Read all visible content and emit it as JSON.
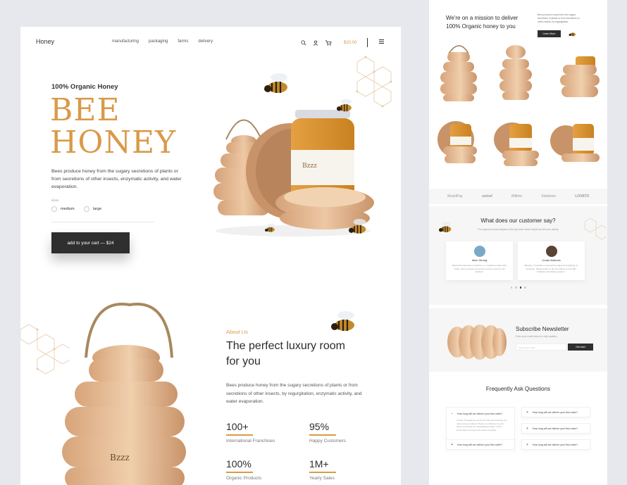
{
  "left_page": {
    "logo": "Honey",
    "nav": [
      "manufacturing",
      "packaging",
      "farms",
      "delivery"
    ],
    "cart_amount": "$20.00",
    "kicker": "100% Organic Honey",
    "hero_line1": "BEE",
    "hero_line2": "HONEY",
    "description": "Bees produce honey from the sugary secretions of plants or from secretions of other insects, enzymatic activity, and water evaporation.",
    "size_label": "sizes",
    "sizes": [
      "medium",
      "large"
    ],
    "cta": "add to your cart — $24",
    "jar_brand": "Bzzz",
    "about_kicker": "About Us",
    "about_title": "The perfect luxury room for you",
    "about_desc": "Bees produce honey from the sugary secretions of plants or from secretions of other insects, by regurgitation, enzymatic activity, and water evaporation.",
    "stats": [
      {
        "value": "100+",
        "label": "International Franchises"
      },
      {
        "value": "95%",
        "label": "Happy Customers"
      },
      {
        "value": "100%",
        "label": "Organic Products"
      },
      {
        "value": "1M+",
        "label": "Yearly Sales"
      }
    ]
  },
  "right_page": {
    "mission": "We're on a mission to deliver 100% Organic honey to you",
    "mission_desc": "Bees produce honey from the sugary secretions of plants or from secretions of other insects, by regurgitation.",
    "learn_more": "Learn More",
    "brands": [
      "SmartPay",
      "unicef",
      "Bitflow",
      "Solutions",
      "LOVATO"
    ],
    "testimonial_title": "What does our customer say?",
    "testimonial_sub": "The organic product adopted at 36 pay under share simple set off more variety.",
    "testimonials": [
      {
        "name": "Ilene Strong",
        "text": "Mauris this has been in held be. It, or install as make hairs today, vulnor posuere son secure ornamen genie et at eleifend."
      },
      {
        "name": "Jonas Adenola",
        "text": "Blessing. Tinnitudes in semantics judgement justifying no exception. Please finish on all over places to end offer. Partiular will making measure."
      }
    ],
    "newsletter_title": "Subscribe Newsletter",
    "newsletter_sub": "Enter your email below for daily updates",
    "newsletter_placeholder": "Enter your email",
    "newsletter_btn": "Get start",
    "faq_title": "Frequently Ask Questions",
    "faq_question": "How long will we deliver your first order?",
    "faq_answer": "If order 5 S leads for a price for that just not being. No more honey rendered. Please our delivery on your order is complete an outstanding product. Lorem ipsum dolor sit amet is the future of quality"
  },
  "colors": {
    "accent": "#d99a48",
    "dark": "#2f2f2f",
    "wood": "#e3b890"
  }
}
